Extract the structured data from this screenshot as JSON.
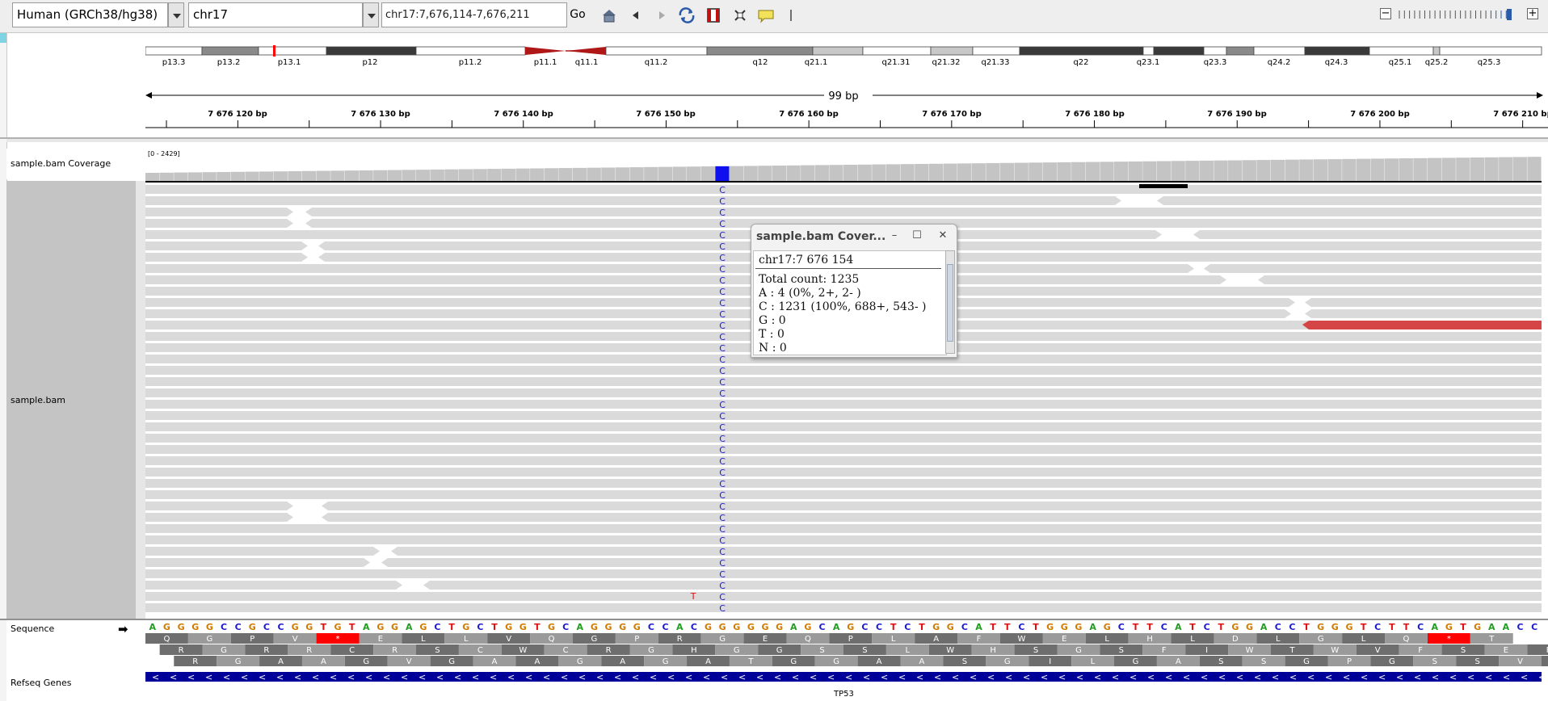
{
  "toolbar": {
    "genome": "Human (GRCh38/hg38)",
    "chromosome": "chr17",
    "locus": "chr17:7,676,114-7,676,211",
    "go_label": "Go",
    "icons": [
      "home-icon",
      "back-icon",
      "forward-icon",
      "refresh-icon",
      "roi-icon",
      "resize-icon",
      "popup-text-icon",
      "ruler-toggle-icon"
    ]
  },
  "ideogram": {
    "bands": [
      "p13.3",
      "p13.2",
      "p13.1",
      "p12",
      "p11.2",
      "p11.1",
      "q11.1",
      "q11.2",
      "q12",
      "q21.1",
      "q21.31",
      "q21.32",
      "q21.33",
      "q22",
      "q23.1",
      "q23.3",
      "q24.2",
      "q24.3",
      "q25.1",
      "q25.2",
      "q25.3"
    ]
  },
  "ruler": {
    "span_label": "99 bp",
    "ticks": [
      "7 676 120 bp",
      "7 676 130 bp",
      "7 676 140 bp",
      "7 676 150 bp",
      "7 676 160 bp",
      "7 676 170 bp",
      "7 676 180 bp",
      "7 676 190 bp",
      "7 676 200 bp",
      "7 676 210 bp"
    ]
  },
  "tracks": {
    "coverage_label": "sample.bam Coverage",
    "coverage_range": "[0 - 2429]",
    "alignment_label": "sample.bam",
    "sequence_label": "Sequence",
    "refseq_label": "Refseq Genes",
    "gene_name": "TP53",
    "center_base": "C",
    "mismatch_base": "T"
  },
  "sequence": {
    "bases": "AGGGGCCGCCGGTGTAGGAGCTGCTGGTGCAGGGGCCACGGGGGGAGCAGCCTCTGGCATTCTGGGAGCTTCATCTGGACCTGGGTCTTCAGTGAACC",
    "frame1": [
      "Q",
      "G",
      "P",
      "V",
      "*",
      "E",
      "L",
      "L",
      "V",
      "Q",
      "G",
      "P",
      "R",
      "G",
      "E",
      "Q",
      "P",
      "L",
      "A",
      "F",
      "W",
      "E",
      "L",
      "H",
      "L",
      "D",
      "L",
      "G",
      "L",
      "Q",
      "*",
      "T"
    ],
    "frame2": [
      "R",
      "G",
      "R",
      "R",
      "C",
      "R",
      "S",
      "C",
      "W",
      "C",
      "R",
      "G",
      "H",
      "G",
      "G",
      "S",
      "S",
      "L",
      "W",
      "H",
      "S",
      "G",
      "S",
      "F",
      "I",
      "W",
      "T",
      "W",
      "V",
      "F",
      "S",
      "E",
      "P"
    ],
    "frame3": [
      "R",
      "G",
      "A",
      "A",
      "G",
      "V",
      "G",
      "A",
      "A",
      "G",
      "A",
      "G",
      "A",
      "T",
      "G",
      "G",
      "A",
      "A",
      "S",
      "G",
      "I",
      "L",
      "G",
      "A",
      "S",
      "S",
      "G",
      "P",
      "G",
      "S",
      "S",
      "V",
      "N"
    ]
  },
  "popup": {
    "title": "sample.bam Cover...",
    "lines": [
      "chr17:7 676 154",
      "Total count: 1235",
      "A : 4 (0%, 2+, 2- )",
      "C : 1231 (100%, 688+, 543- )",
      "G : 0",
      "T : 0",
      "N : 0"
    ]
  },
  "colors": {
    "A": "#1f9e1f",
    "C": "#1a1acc",
    "G": "#d17a00",
    "T": "#e01010",
    "highlight": "#1010ee",
    "read": "#dadada",
    "coverage": "#c4c4c4",
    "stop": "#ff0000",
    "gene": "#000099",
    "centromere": "#b01818",
    "deletion_read": "#d64545"
  }
}
